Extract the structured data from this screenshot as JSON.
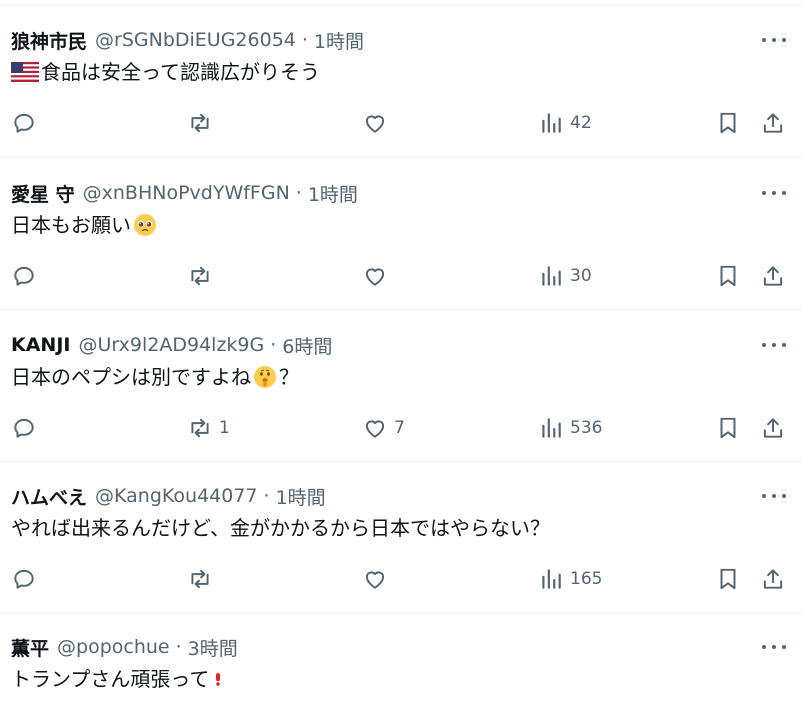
{
  "posts": [
    {
      "name": "狼神市民",
      "handle": "@rSGNbDiEUG26054",
      "separator": "·",
      "time": "1時間",
      "text": "食品は安全って認識広がりそう",
      "lead_emoji": "us-flag-emoji",
      "trail_emoji": null,
      "trail_text": "",
      "counts": {
        "reply": "",
        "repost": "",
        "like": "",
        "views": "42"
      }
    },
    {
      "name": "愛星 守",
      "handle": "@xnBHNoPvdYWfFGN",
      "separator": "·",
      "time": "1時間",
      "text": "日本もお願い",
      "lead_emoji": null,
      "trail_emoji": "pleading-face-emoji",
      "trail_text": "",
      "counts": {
        "reply": "",
        "repost": "",
        "like": "",
        "views": "30"
      }
    },
    {
      "name": "KANJI",
      "handle": "@Urx9l2AD94lzk9G",
      "separator": "·",
      "time": "6時間",
      "text": "日本のペプシは別ですよね",
      "lead_emoji": null,
      "trail_emoji": "shushing-face-emoji",
      "trail_text": "？",
      "counts": {
        "reply": "",
        "repost": "1",
        "like": "7",
        "views": "536"
      }
    },
    {
      "name": "ハムべえ",
      "handle": "@KangKou44077",
      "separator": "·",
      "time": "1時間",
      "text": "やれば出来るんだけど、金がかかるから日本ではやらない？",
      "lead_emoji": null,
      "trail_emoji": null,
      "trail_text": "",
      "counts": {
        "reply": "",
        "repost": "",
        "like": "",
        "views": "165"
      }
    },
    {
      "name": "薫平",
      "handle": "@popochue",
      "separator": "·",
      "time": "3時間",
      "text": "トランプさん頑張って",
      "lead_emoji": null,
      "trail_emoji": "exclamation-mark-emoji",
      "trail_text": "",
      "counts": null
    }
  ],
  "icons": {
    "reply": "speech-bubble-icon",
    "repost": "repost-arrows-icon",
    "like": "heart-icon",
    "views": "bar-chart-icon",
    "bookmark": "bookmark-icon",
    "share": "share-upload-icon",
    "more": "more-dots-icon"
  },
  "colors": {
    "text": "#0f1419",
    "secondary": "#536471",
    "divider": "#eff3f4",
    "exclamation": "#e0242b"
  }
}
